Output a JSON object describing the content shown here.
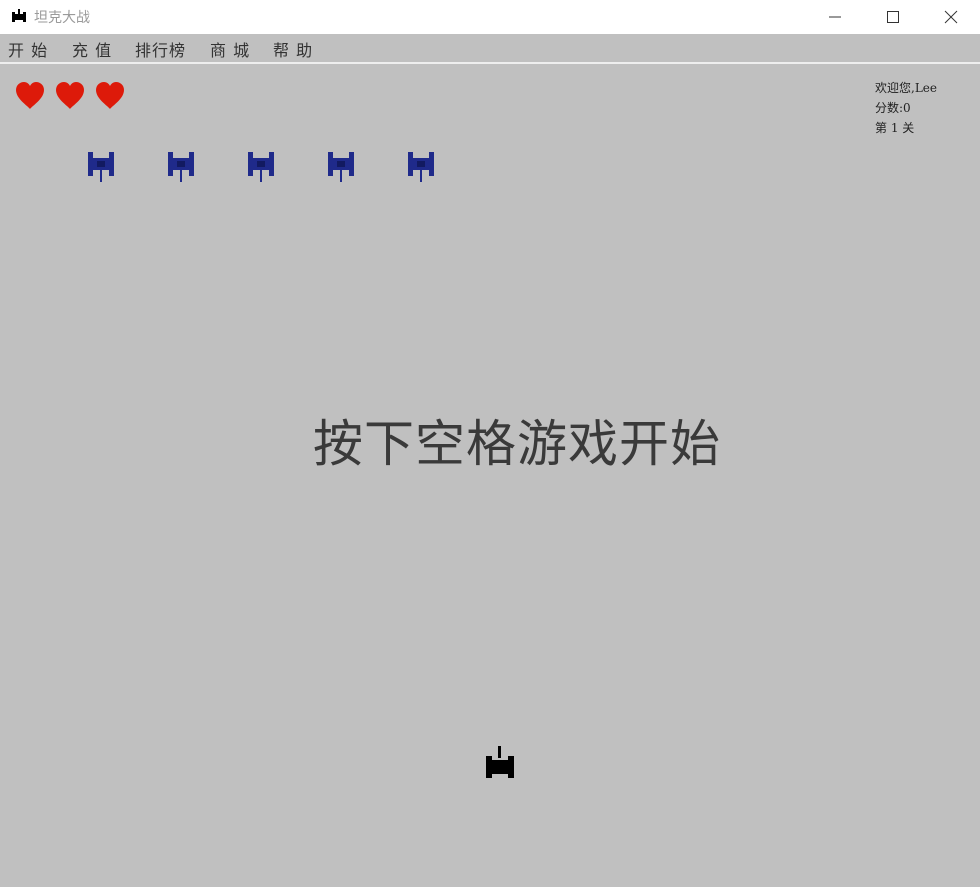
{
  "window": {
    "title": "坦克大战",
    "controls": [
      "minimize",
      "maximize",
      "close"
    ]
  },
  "menu": {
    "items": [
      "开 始",
      "充 值",
      "排行榜",
      "商 城",
      "帮 助"
    ]
  },
  "hud": {
    "lives": 3,
    "welcome": "欢迎您,Lee",
    "score": "分数:0",
    "level": "第 1 关"
  },
  "game": {
    "prompt": "按下空格游戏开始",
    "enemy_tanks": 5,
    "player_tank": 1
  },
  "colors": {
    "background": "#c0c0c0",
    "heart": "#dd1a0a",
    "enemy": "#1f2a8a",
    "player": "#000000"
  },
  "icons": {
    "app": "tank-icon",
    "life": "heart-icon",
    "enemy": "enemy-tank-icon",
    "player": "player-tank-icon"
  }
}
